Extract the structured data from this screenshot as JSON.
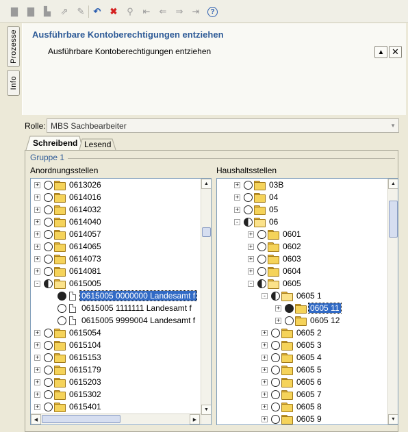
{
  "toolbar": {
    "icons": [
      "new-icon",
      "save-icon",
      "print-icon",
      "export-icon",
      "edit-icon",
      "undo-icon",
      "delete-icon",
      "search-icon",
      "first-icon",
      "previous-icon",
      "next-icon",
      "last-icon",
      "help-icon"
    ],
    "help_glyph": "?"
  },
  "sidetabs": {
    "prozesse": "Prozesse",
    "info": "Info"
  },
  "card": {
    "title": "Ausführbare Kontoberechtigungen entziehen",
    "description": "Ausführbare Kontoberechtigungen entziehen"
  },
  "rolle": {
    "label": "Rolle:",
    "value": "MBS Sachbearbeiter"
  },
  "tabs": [
    {
      "label": "Schreibend",
      "active": true
    },
    {
      "label": "Lesend",
      "active": false
    }
  ],
  "group": {
    "label": "Gruppe 1"
  },
  "left_panel": {
    "label": "Anordnungsstellen",
    "rows": [
      {
        "text": "0613026",
        "level": 0,
        "expander": "+",
        "state": "empty",
        "kind": "folder"
      },
      {
        "text": "0614016",
        "level": 0,
        "expander": "+",
        "state": "empty",
        "kind": "folder"
      },
      {
        "text": "0614032",
        "level": 0,
        "expander": "+",
        "state": "empty",
        "kind": "folder"
      },
      {
        "text": "0614040",
        "level": 0,
        "expander": "+",
        "state": "empty",
        "kind": "folder"
      },
      {
        "text": "0614057",
        "level": 0,
        "expander": "+",
        "state": "empty",
        "kind": "folder"
      },
      {
        "text": "0614065",
        "level": 0,
        "expander": "+",
        "state": "empty",
        "kind": "folder"
      },
      {
        "text": "0614073",
        "level": 0,
        "expander": "+",
        "state": "empty",
        "kind": "folder"
      },
      {
        "text": "0614081",
        "level": 0,
        "expander": "+",
        "state": "empty",
        "kind": "folder"
      },
      {
        "text": "0615005",
        "level": 0,
        "expander": "-",
        "state": "half",
        "kind": "folder-open"
      },
      {
        "text": "0615005 0000000 Landesamt f",
        "level": 1,
        "expander": "",
        "state": "full",
        "kind": "doc",
        "selected": true
      },
      {
        "text": "0615005 1111111 Landesamt f",
        "level": 1,
        "expander": "",
        "state": "empty",
        "kind": "doc"
      },
      {
        "text": "0615005 9999004 Landesamt f",
        "level": 1,
        "expander": "",
        "state": "empty",
        "kind": "doc"
      },
      {
        "text": "0615054",
        "level": 0,
        "expander": "+",
        "state": "empty",
        "kind": "folder"
      },
      {
        "text": "0615104",
        "level": 0,
        "expander": "+",
        "state": "empty",
        "kind": "folder"
      },
      {
        "text": "0615153",
        "level": 0,
        "expander": "+",
        "state": "empty",
        "kind": "folder"
      },
      {
        "text": "0615179",
        "level": 0,
        "expander": "+",
        "state": "empty",
        "kind": "folder"
      },
      {
        "text": "0615203",
        "level": 0,
        "expander": "+",
        "state": "empty",
        "kind": "folder"
      },
      {
        "text": "0615302",
        "level": 0,
        "expander": "+",
        "state": "empty",
        "kind": "folder"
      },
      {
        "text": "0615401",
        "level": 0,
        "expander": "+",
        "state": "empty",
        "kind": "folder"
      }
    ]
  },
  "right_panel": {
    "label": "Haushaltsstellen",
    "rows": [
      {
        "text": "03B",
        "level": 0,
        "expander": "+",
        "state": "empty",
        "kind": "folder"
      },
      {
        "text": "04",
        "level": 0,
        "expander": "+",
        "state": "empty",
        "kind": "folder"
      },
      {
        "text": "05",
        "level": 0,
        "expander": "+",
        "state": "empty",
        "kind": "folder"
      },
      {
        "text": "06",
        "level": 0,
        "expander": "-",
        "state": "half",
        "kind": "folder-open"
      },
      {
        "text": "0601",
        "level": 1,
        "expander": "+",
        "state": "empty",
        "kind": "folder"
      },
      {
        "text": "0602",
        "level": 1,
        "expander": "+",
        "state": "empty",
        "kind": "folder"
      },
      {
        "text": "0603",
        "level": 1,
        "expander": "+",
        "state": "empty",
        "kind": "folder"
      },
      {
        "text": "0604",
        "level": 1,
        "expander": "+",
        "state": "empty",
        "kind": "folder"
      },
      {
        "text": "0605",
        "level": 1,
        "expander": "-",
        "state": "half",
        "kind": "folder-open"
      },
      {
        "text": "0605 1",
        "level": 2,
        "expander": "-",
        "state": "half",
        "kind": "folder-open"
      },
      {
        "text": "0605 11",
        "level": 3,
        "expander": "+",
        "state": "full",
        "kind": "folder",
        "selected": true
      },
      {
        "text": "0605 12",
        "level": 3,
        "expander": "+",
        "state": "empty",
        "kind": "folder"
      },
      {
        "text": "0605 2",
        "level": 2,
        "expander": "+",
        "state": "empty",
        "kind": "folder"
      },
      {
        "text": "0605 3",
        "level": 2,
        "expander": "+",
        "state": "empty",
        "kind": "folder"
      },
      {
        "text": "0605 4",
        "level": 2,
        "expander": "+",
        "state": "empty",
        "kind": "folder"
      },
      {
        "text": "0605 5",
        "level": 2,
        "expander": "+",
        "state": "empty",
        "kind": "folder"
      },
      {
        "text": "0605 6",
        "level": 2,
        "expander": "+",
        "state": "empty",
        "kind": "folder"
      },
      {
        "text": "0605 7",
        "level": 2,
        "expander": "+",
        "state": "empty",
        "kind": "folder"
      },
      {
        "text": "0605 8",
        "level": 2,
        "expander": "+",
        "state": "empty",
        "kind": "folder"
      },
      {
        "text": "0605 9",
        "level": 2,
        "expander": "+",
        "state": "empty",
        "kind": "folder"
      }
    ]
  },
  "colors": {
    "title": "#2e5b97",
    "selection": "#316ac5",
    "folder": "#f5d35a"
  }
}
